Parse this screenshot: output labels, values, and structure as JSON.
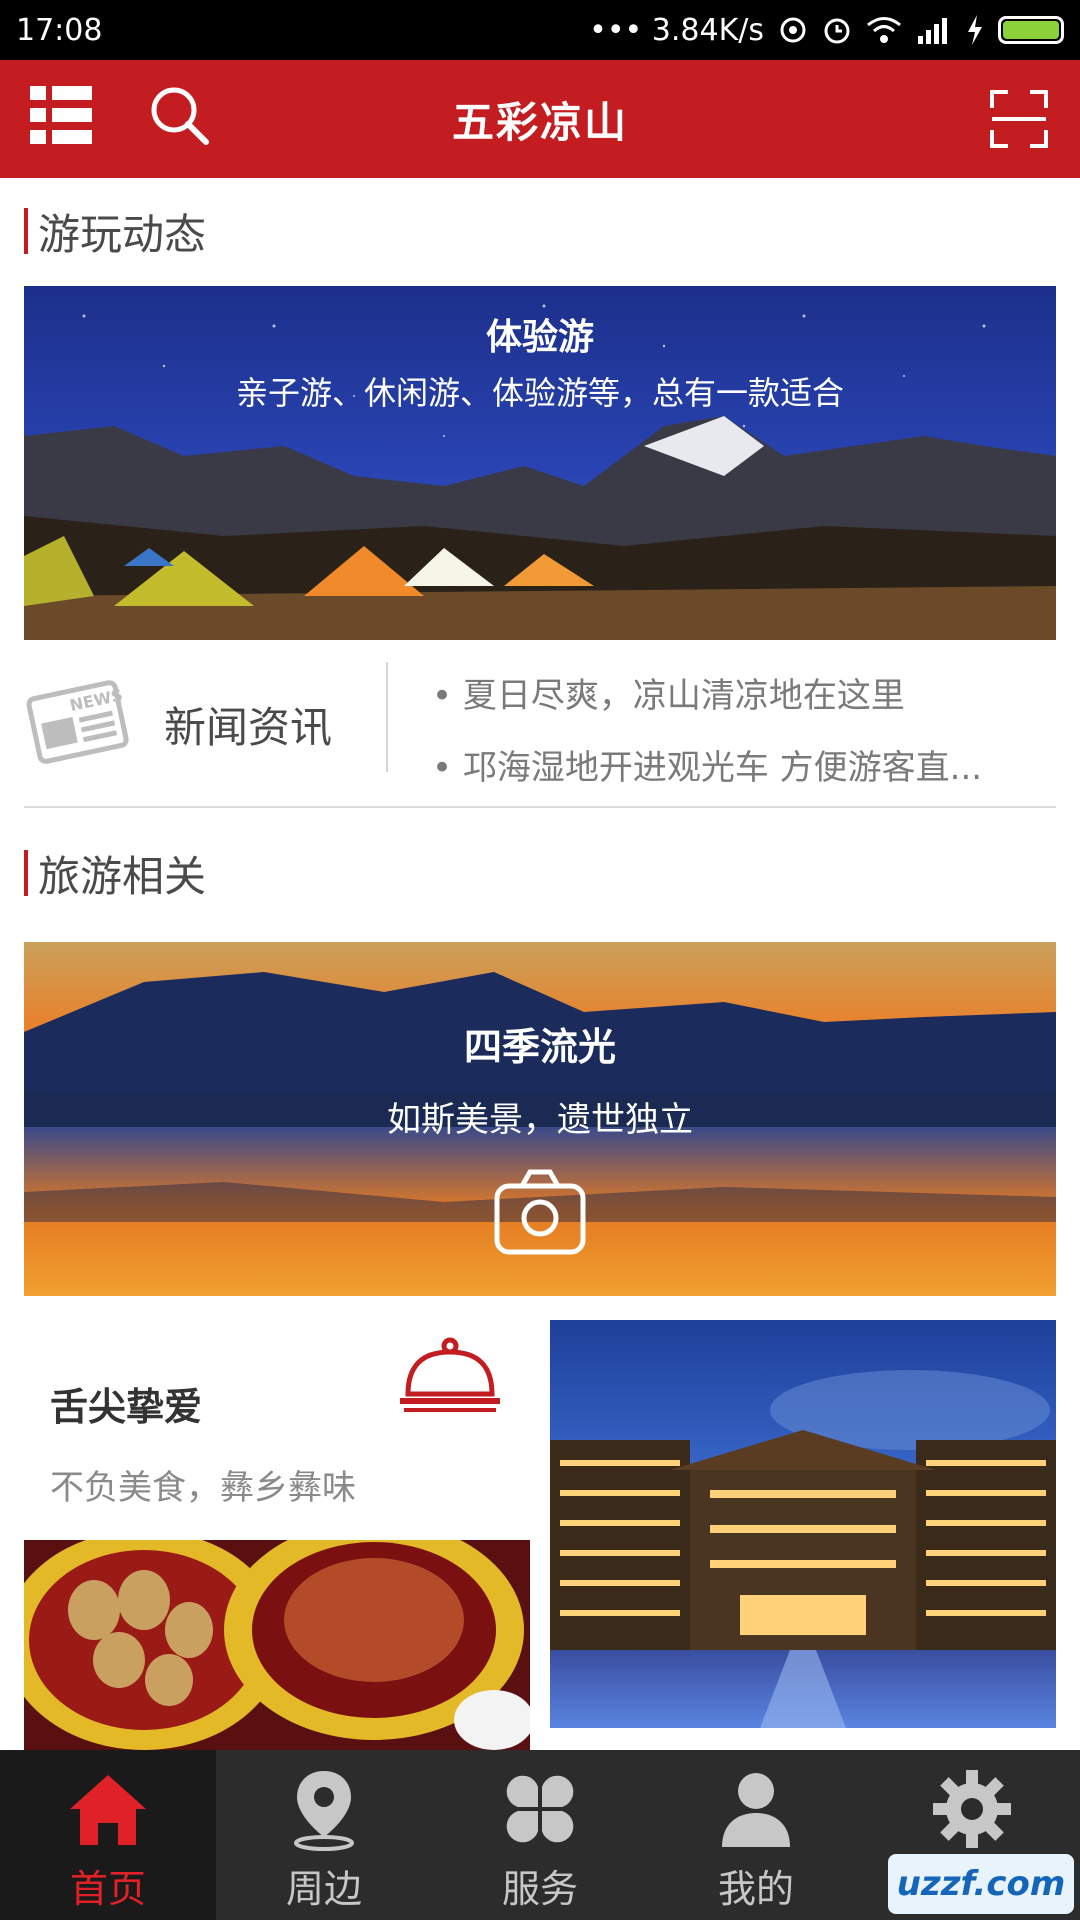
{
  "status_bar": {
    "time": "17:08",
    "network_speed": "••• 3.84K/s",
    "battery_level": 1.0
  },
  "header": {
    "title": "五彩凉山",
    "menu_icon": "list-icon",
    "search_icon": "search-icon",
    "scan_icon": "scan-icon"
  },
  "play_section": {
    "title": "游玩动态",
    "banner": {
      "title": "体验游",
      "subtitle": "亲子游、休闲游、体验游等，总有一款适合"
    }
  },
  "news": {
    "label": "新闻资讯",
    "icon": "newspaper-icon",
    "icon_text": "NEWS",
    "items": [
      "夏日尽爽，凉山清凉地在这里",
      "邛海湿地开进观光车 方便游客直..."
    ]
  },
  "travel_section": {
    "title": "旅游相关",
    "banner": {
      "title": "四季流光",
      "subtitle": "如斯美景，遗世独立",
      "icon": "camera-icon"
    },
    "food": {
      "title": "舌尖挚爱",
      "subtitle": "不负美食，彝乡彝味",
      "icon": "food-cloche-icon"
    }
  },
  "bottom_nav": {
    "items": [
      {
        "label": "首页",
        "icon": "home-icon",
        "active": true
      },
      {
        "label": "周边",
        "icon": "location-pin-icon",
        "active": false
      },
      {
        "label": "服务",
        "icon": "grid-petals-icon",
        "active": false
      },
      {
        "label": "我的",
        "icon": "user-icon",
        "active": false
      },
      {
        "label": "",
        "icon": "gear-icon",
        "active": false
      }
    ]
  },
  "watermark": "uzzf.com",
  "colors": {
    "brand": "#c31d22",
    "active_nav": "#e02128",
    "nav_bg": "#2c2c2c"
  }
}
